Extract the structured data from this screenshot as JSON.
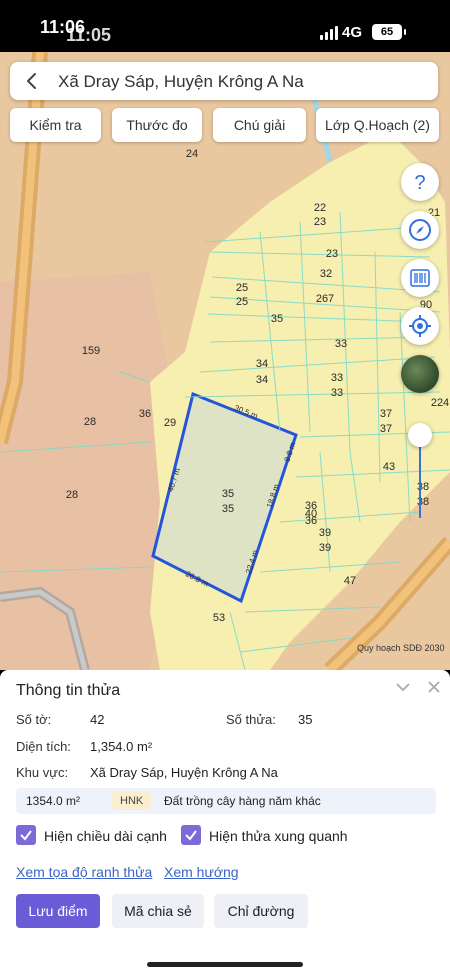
{
  "status": {
    "time": "11:06",
    "time_ghost": "11:05",
    "network": "4G",
    "battery": "65"
  },
  "search": {
    "title": "Xã Dray Sáp, Huyện Krông A Na"
  },
  "tools": {
    "check": "Kiểm tra",
    "measure": "Thước đo",
    "legend": "Chú giải",
    "layers": "Lớp Q.Hoạch (2)"
  },
  "map": {
    "labels": [
      "24",
      "22",
      "23",
      "23",
      "32",
      "25",
      "25",
      "267",
      "35",
      "33",
      "159",
      "34",
      "34",
      "33",
      "33",
      "36",
      "29",
      "28",
      "37",
      "37",
      "43",
      "35",
      "35",
      "36",
      "40",
      "36",
      "39",
      "39",
      "38",
      "38",
      "28",
      "47",
      "53",
      "21",
      "90",
      "224"
    ],
    "dims": [
      "30.5 m",
      "8.8 m",
      "40.7 m",
      "18.8 m",
      "22.4 m",
      "26.8 m"
    ],
    "attribution": "Quy hoạch SDĐ 2030"
  },
  "panel": {
    "title": "Thông tin thửa",
    "sheet_label": "Số tờ:",
    "sheet_value": "42",
    "parcel_label": "Số thửa:",
    "parcel_value": "35",
    "area_label": "Diện tích:",
    "area_value": "1,354.0 m²",
    "region_label": "Khu vực:",
    "region_value": "Xã Dray Sáp, Huyện Krông A Na",
    "land": {
      "area": "1354.0 m²",
      "code": "HNK",
      "desc": "Đất trồng cây hàng năm khác"
    },
    "check_edges": "Hiện chiều dài cạnh",
    "check_neighbors": "Hiện thửa xung quanh",
    "link_coords": "Xem tọa độ ranh thửa",
    "link_direction": "Xem hướng",
    "btn_save": "Lưu điểm",
    "btn_share": "Mã chia sẻ",
    "btn_route": "Chỉ đường"
  },
  "colors": {
    "accent": "#6a5bd6",
    "link": "#3b63c8",
    "parcel_border": "#2455d8",
    "zone_yellow": "#f7f0b2",
    "zone_orange": "#e9c8a0"
  }
}
